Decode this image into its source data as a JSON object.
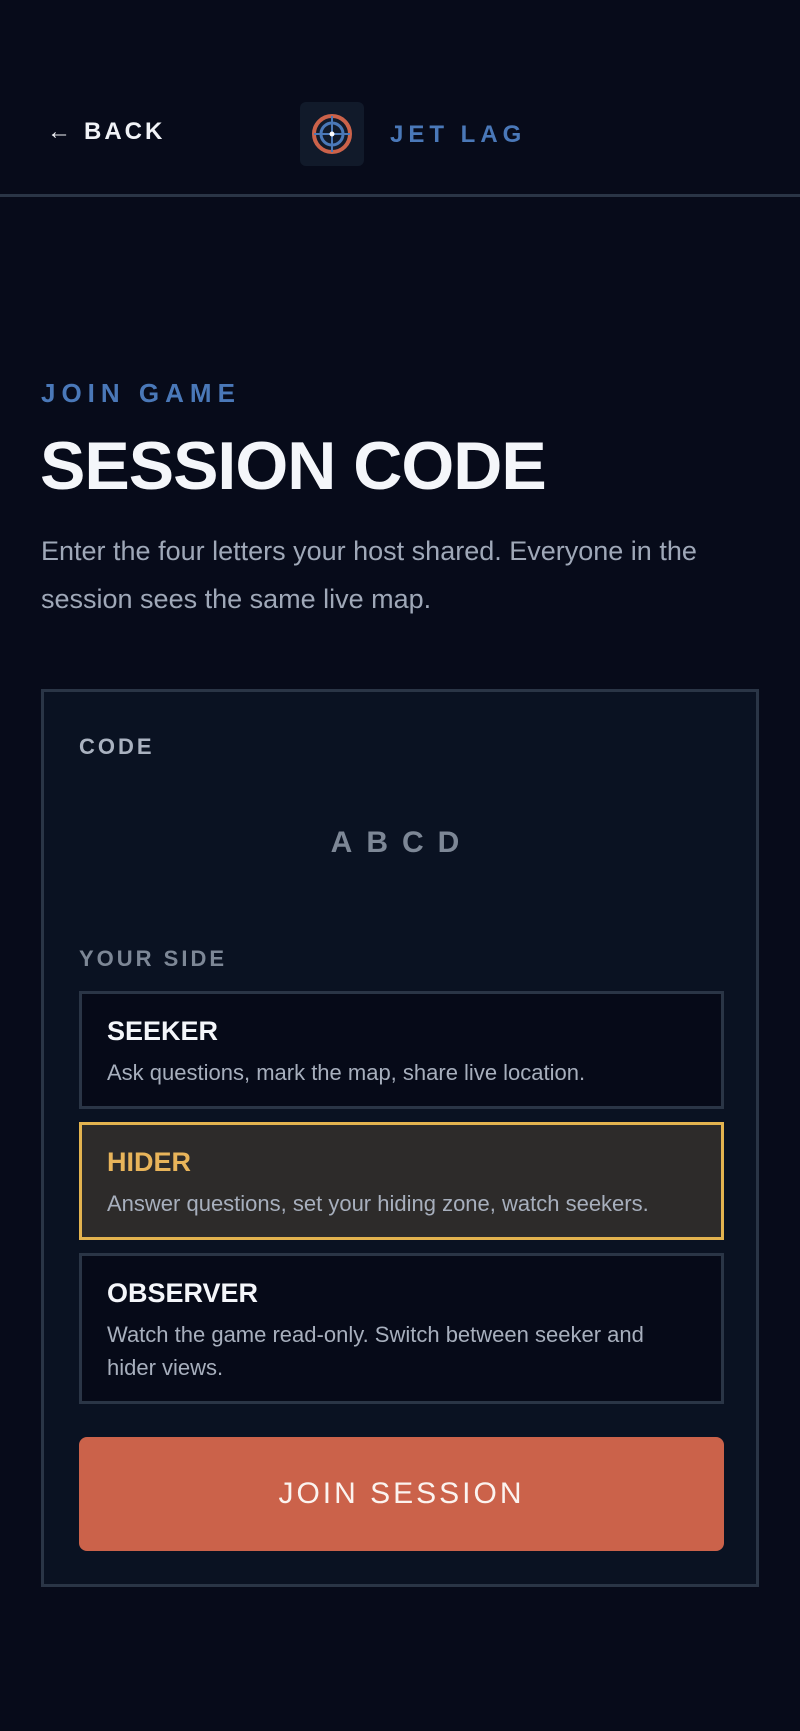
{
  "header": {
    "back_label": "BACK",
    "back_arrow": "←",
    "logo_icon": "crosshair-target-icon",
    "brand": "JET LAG"
  },
  "intro": {
    "eyebrow": "JOIN GAME",
    "title": "SESSION CODE",
    "description": "Enter the four letters your host shared. Everyone in the session sees the same live map."
  },
  "form": {
    "code_label": "CODE",
    "code_placeholder": "ABCD",
    "code_value": "",
    "side_label": "YOUR SIDE",
    "options": [
      {
        "name": "SEEKER",
        "description": "Ask questions, mark the map, share live location.",
        "selected": false
      },
      {
        "name": "HIDER",
        "description": "Answer questions, set your hiding zone, watch seekers.",
        "selected": true
      },
      {
        "name": "OBSERVER",
        "description": "Watch the game read-only. Switch between seeker and hider views.",
        "selected": false
      }
    ],
    "submit_label": "JOIN SESSION"
  },
  "colors": {
    "background": "#070b1a",
    "accent_blue": "#4a78b8",
    "selected_border": "#e3b34f",
    "button": "#cb624a"
  }
}
